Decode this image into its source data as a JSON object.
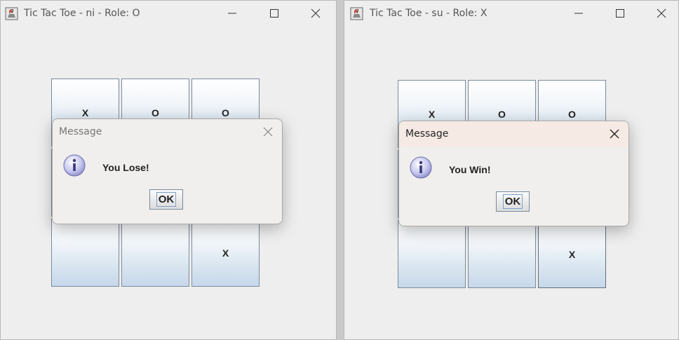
{
  "left_window": {
    "title": "Tic Tac Toe - ni - Role: O",
    "board": [
      "X",
      "O",
      "O",
      "",
      "",
      "",
      "",
      "",
      "X"
    ],
    "dialog": {
      "title": "Message",
      "message": "You Lose!",
      "ok_label": "OK"
    }
  },
  "right_window": {
    "title": "Tic Tac Toe - su - Role: X",
    "board": [
      "X",
      "O",
      "O",
      "",
      "",
      "",
      "",
      "",
      "X"
    ],
    "dialog": {
      "title": "Message",
      "message": "You Win!",
      "ok_label": "OK"
    }
  },
  "icons": {
    "app": "java-cup-icon",
    "minimize": "minimize-icon",
    "maximize": "maximize-icon",
    "close": "close-icon",
    "info": "info-icon"
  }
}
